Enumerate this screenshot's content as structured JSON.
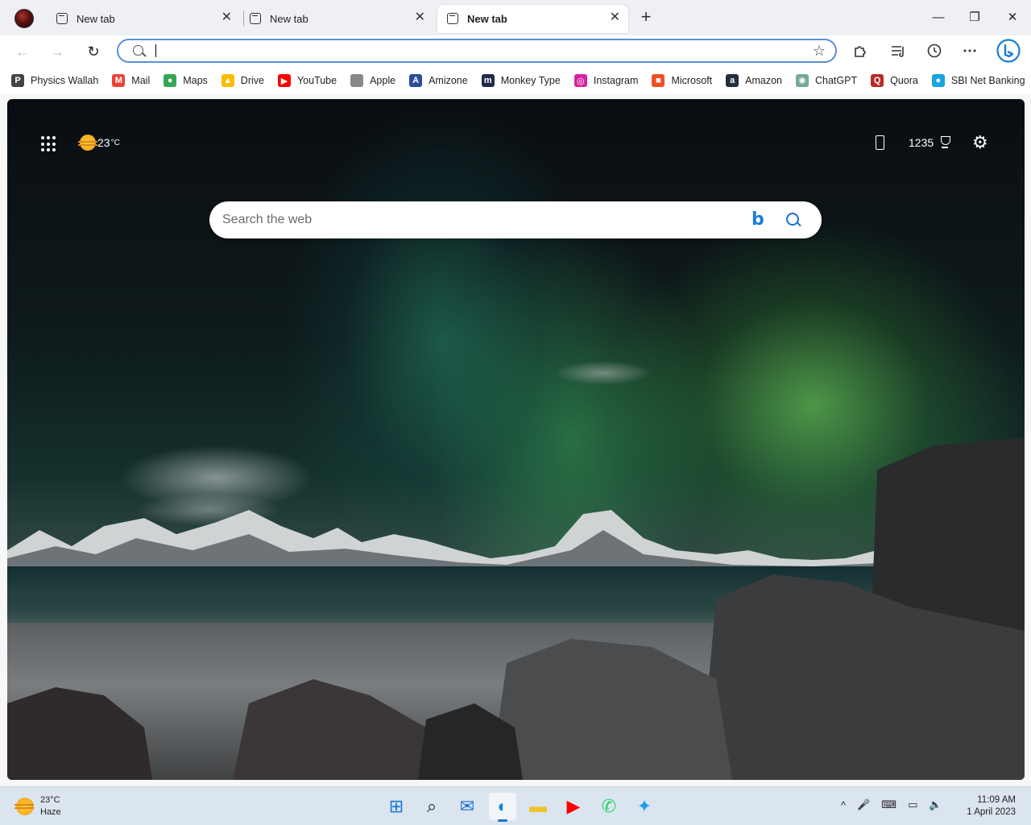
{
  "tabs": [
    {
      "title": "New tab",
      "close": "✕",
      "active": false
    },
    {
      "title": "New tab",
      "close": "✕",
      "active": false
    },
    {
      "title": "New tab",
      "close": "✕",
      "active": true
    }
  ],
  "new_tab_glyph": "+",
  "window_controls": {
    "minimize": "—",
    "maximize": "❐",
    "close": "✕"
  },
  "nav": {
    "back": "←",
    "forward": "→",
    "reload": "↻"
  },
  "address_bar": {
    "value": "",
    "placeholder": ""
  },
  "toolbar_icons": [
    "favorites-add-icon",
    "extensions-icon",
    "collections-icon",
    "history-icon",
    "more-icon",
    "bing-chat-icon"
  ],
  "bookmarks": [
    {
      "label": "Physics Wallah",
      "icon": "physics-wallah-icon",
      "color": "#444444",
      "glyph": "P"
    },
    {
      "label": "Mail",
      "icon": "gmail-icon",
      "color": "#ea4335",
      "glyph": "M"
    },
    {
      "label": "Maps",
      "icon": "maps-icon",
      "color": "#34a853",
      "glyph": "●"
    },
    {
      "label": "Drive",
      "icon": "drive-icon",
      "color": "#fbbc04",
      "glyph": "▲"
    },
    {
      "label": "YouTube",
      "icon": "youtube-icon",
      "color": "#ff0000",
      "glyph": "▶"
    },
    {
      "label": "Apple",
      "icon": "apple-icon",
      "color": "#888888",
      "glyph": ""
    },
    {
      "label": "Amizone",
      "icon": "amizone-icon",
      "color": "#2a4d9c",
      "glyph": "A"
    },
    {
      "label": "Monkey Type",
      "icon": "monkeytype-icon",
      "color": "#1e2a4a",
      "glyph": "m"
    },
    {
      "label": "Instagram",
      "icon": "instagram-icon",
      "color": "#d6249f",
      "glyph": "◎"
    },
    {
      "label": "Microsoft",
      "icon": "microsoft-icon",
      "color": "#f25022",
      "glyph": "■"
    },
    {
      "label": "Amazon",
      "icon": "amazon-icon",
      "color": "#232f3e",
      "glyph": "a"
    },
    {
      "label": "ChatGPT",
      "icon": "chatgpt-icon",
      "color": "#74aa9c",
      "glyph": "✺"
    },
    {
      "label": "Quora",
      "icon": "quora-icon",
      "color": "#b92b27",
      "glyph": "Q"
    },
    {
      "label": "SBI Net Banking",
      "icon": "sbi-icon",
      "color": "#1aa3e0",
      "glyph": "●"
    }
  ],
  "ntp": {
    "weather_temp": "23",
    "weather_unit": "°C",
    "rewards_points": "1235",
    "search_placeholder": "Search the web"
  },
  "taskbar": {
    "weather_temp": "23°C",
    "weather_desc": "Haze",
    "apps": [
      {
        "name": "start-icon",
        "color": "#1a73d6",
        "glyph": "⊞",
        "active": false
      },
      {
        "name": "search-icon",
        "color": "#222222",
        "glyph": "⌕",
        "active": false
      },
      {
        "name": "mail-icon",
        "color": "#1a6fd0",
        "glyph": "✉",
        "active": false
      },
      {
        "name": "edge-icon",
        "color": "#0f8bd6",
        "glyph": "◐",
        "active": true
      },
      {
        "name": "file-explorer-icon",
        "color": "#f2c12e",
        "glyph": "▬",
        "active": false
      },
      {
        "name": "youtube-icon",
        "color": "#ff0000",
        "glyph": "▶",
        "active": false
      },
      {
        "name": "whatsapp-icon",
        "color": "#25d366",
        "glyph": "✆",
        "active": false
      },
      {
        "name": "twitter-icon",
        "color": "#1d9bf0",
        "glyph": "✦",
        "active": false
      }
    ],
    "tray": {
      "chevron": "^",
      "mic": "🎤",
      "keyboard": "⌨",
      "network": "▭",
      "volume": "🔈"
    },
    "time": "11:09 AM",
    "date": "1 April 2023"
  }
}
